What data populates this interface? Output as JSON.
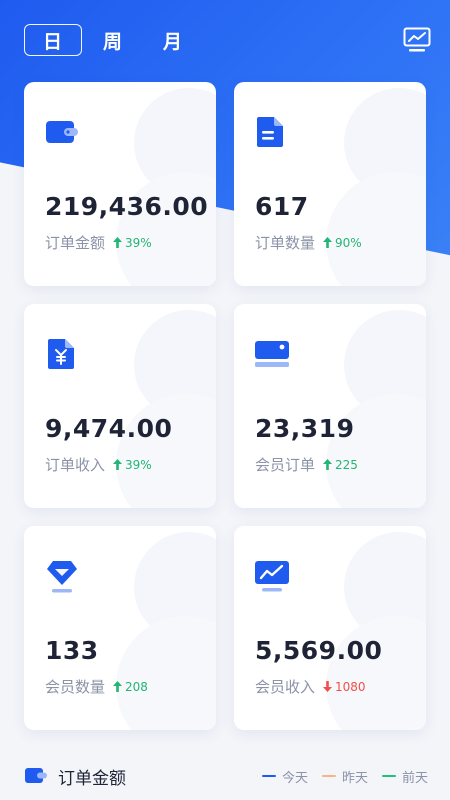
{
  "tabs": [
    {
      "label": "日",
      "active": true
    },
    {
      "label": "周",
      "active": false
    },
    {
      "label": "月",
      "active": false
    }
  ],
  "header": {
    "trend_icon": "trend-chart-icon"
  },
  "cards": [
    {
      "icon": "wallet-icon",
      "value": "219,436.00",
      "label": "订单金额",
      "delta": "39%",
      "direction": "up"
    },
    {
      "icon": "document-icon",
      "value": "617",
      "label": "订单数量",
      "delta": "90%",
      "direction": "up"
    },
    {
      "icon": "yuan-document-icon",
      "value": "9,474.00",
      "label": "订单收入",
      "delta": "39%",
      "direction": "up"
    },
    {
      "icon": "card-icon",
      "value": "23,319",
      "label": "会员订单",
      "delta": "225",
      "direction": "up"
    },
    {
      "icon": "diamond-icon",
      "value": "133",
      "label": "会员数量",
      "delta": "208",
      "direction": "up"
    },
    {
      "icon": "monitor-trend-icon",
      "value": "5,569.00",
      "label": "会员收入",
      "delta": "1080",
      "direction": "down"
    }
  ],
  "section": {
    "title": "订单金额",
    "icon": "wallet-icon",
    "legend": [
      {
        "label": "今天",
        "color": "#1f5bef"
      },
      {
        "label": "昨天",
        "color": "#f7b48b"
      },
      {
        "label": "前天",
        "color": "#22c17a"
      }
    ]
  },
  "colors": {
    "accent": "#1f5bef",
    "up": "#22b573",
    "down": "#f0504b"
  }
}
